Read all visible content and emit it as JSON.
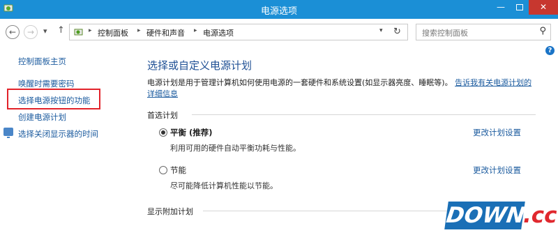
{
  "window": {
    "title": "电源选项",
    "minimize": "—",
    "close": "✕"
  },
  "nav": {
    "back": "←",
    "forward": "→",
    "recent": "▾",
    "up": "↑"
  },
  "address": {
    "crumbs": [
      "控制面板",
      "硬件和声音",
      "电源选项"
    ],
    "separator": "▸",
    "dropdown": "▾",
    "refresh": "↻"
  },
  "search": {
    "placeholder": "搜索控制面板",
    "icon": "⚲"
  },
  "help": "?",
  "sidebar": {
    "items": [
      {
        "label": "控制面板主页"
      },
      {
        "label": "唤醒时需要密码"
      },
      {
        "label": "选择电源按钮的功能"
      },
      {
        "label": "创建电源计划"
      },
      {
        "label": "选择关闭显示器的时间"
      }
    ]
  },
  "main": {
    "heading": "选择或自定义电源计划",
    "description": "电源计划是用于管理计算机如何使用电源的一套硬件和系统设置(如显示器亮度、睡眠等)。",
    "description_link": "告诉我有关电源计划的详细信息",
    "preferred_label": "首选计划",
    "plans": [
      {
        "name": "平衡 (推荐)",
        "desc": "利用可用的硬件自动平衡功耗与性能。",
        "selected": true,
        "change": "更改计划设置"
      },
      {
        "name": "节能",
        "desc": "尽可能降低计算机性能以节能。",
        "selected": false,
        "change": "更改计划设置"
      }
    ],
    "additional_label": "显示附加计划"
  },
  "watermark": {
    "word": "DOWN",
    "suffix": ".cc"
  },
  "colors": {
    "titlebar": "#1b8fd6",
    "link": "#1a5a9e",
    "heading": "#1e4f94",
    "highlight": "#e2222a",
    "close": "#c7372f"
  }
}
